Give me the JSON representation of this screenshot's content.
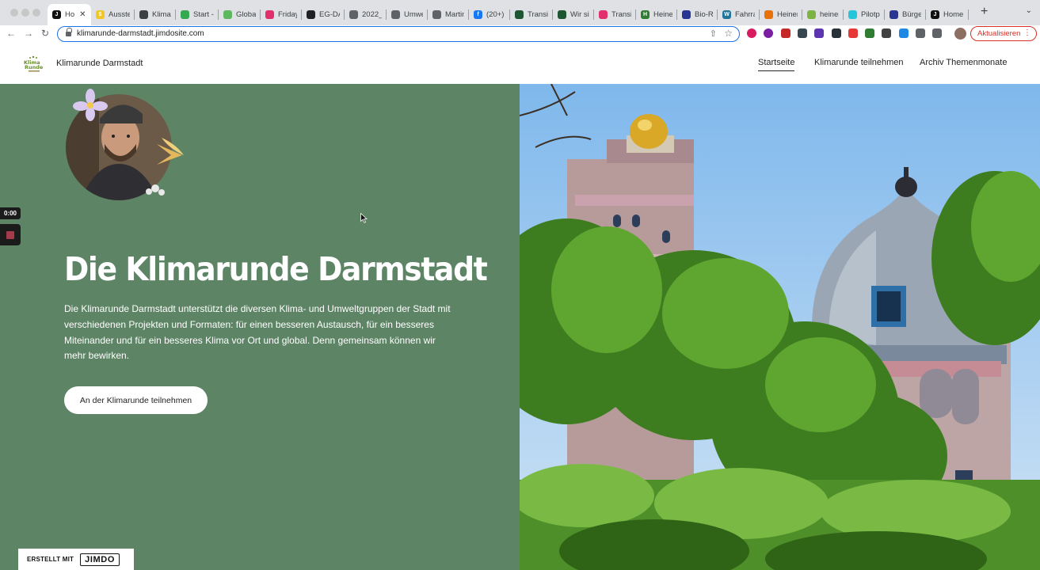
{
  "browser": {
    "tabs": [
      {
        "label": "Ho",
        "icon": "jimdo-icon",
        "color": "#111111",
        "glyph": "J",
        "active": true
      },
      {
        "label": "Ausste",
        "icon": "dollar-icon",
        "color": "#f3c623",
        "glyph": "$"
      },
      {
        "label": "Klima",
        "icon": "box-icon",
        "color": "#3c4043",
        "glyph": ""
      },
      {
        "label": "Start -",
        "icon": "green-circle-icon",
        "color": "#34a853",
        "glyph": ""
      },
      {
        "label": "Global",
        "icon": "green-circle-icon",
        "color": "#5fb85f",
        "glyph": ""
      },
      {
        "label": "Friday",
        "icon": "instagram-icon",
        "color": "#e1306c",
        "glyph": ""
      },
      {
        "label": "EG-DA",
        "icon": "diamond-icon",
        "color": "#202124",
        "glyph": ""
      },
      {
        "label": "2022_",
        "icon": "globe-icon",
        "color": "#5f6368",
        "glyph": ""
      },
      {
        "label": "Umwe",
        "icon": "globe-icon",
        "color": "#5f6368",
        "glyph": ""
      },
      {
        "label": "Martin",
        "icon": "globe-icon",
        "color": "#5f6368",
        "glyph": ""
      },
      {
        "label": "(20+)",
        "icon": "facebook-icon",
        "color": "#1877f2",
        "glyph": "f"
      },
      {
        "label": "Transi",
        "icon": "translate-icon",
        "color": "#1e5631",
        "glyph": ""
      },
      {
        "label": "Wir sir",
        "icon": "translate-icon",
        "color": "#1e5631",
        "glyph": ""
      },
      {
        "label": "Transi",
        "icon": "instagram-icon",
        "color": "#e1306c",
        "glyph": ""
      },
      {
        "label": "Heine",
        "icon": "h-icon",
        "color": "#2e7d32",
        "glyph": "H"
      },
      {
        "label": "Bio-Re",
        "icon": "person-icon",
        "color": "#283593",
        "glyph": ""
      },
      {
        "label": "Fahrra",
        "icon": "wordpress-icon",
        "color": "#21759b",
        "glyph": "W"
      },
      {
        "label": "Heiner",
        "icon": "photo-icon",
        "color": "#e8710a",
        "glyph": ""
      },
      {
        "label": "heiner",
        "icon": "house-icon",
        "color": "#7cb342",
        "glyph": ""
      },
      {
        "label": "Pilotpr",
        "icon": "flag-icon",
        "color": "#26c6da",
        "glyph": ""
      },
      {
        "label": "Bürge",
        "icon": "person-icon",
        "color": "#283593",
        "glyph": ""
      },
      {
        "label": "Home",
        "icon": "jimdo-icon",
        "color": "#111111",
        "glyph": "J"
      }
    ],
    "url": "klimarunde-darmstadt.jimdosite.com",
    "update_label": "Aktualisieren",
    "extension_colors": [
      "#d81b60",
      "#7b1fa2",
      "#c62828",
      "#37474f",
      "#5e35b1",
      "#263238",
      "#e53935",
      "#2e7d32",
      "#424242",
      "#1e88e5",
      "#5f6368",
      "#5f6368"
    ]
  },
  "site": {
    "brand": "Klimarunde Darmstadt",
    "nav": {
      "home": "Startseite",
      "join": "Klimarunde teilnehmen",
      "archive": "Archiv Themenmonate"
    },
    "hero": {
      "title": "Die Klimarunde Darmstadt",
      "text": "Die Klimarunde Darmstadt unterstützt die diversen Klima- und Umweltgruppen der Stadt mit verschiedenen Projekten und Formaten: für einen besseren Austausch, für ein besseres Miteinander und für ein besseres Klima vor Ort und global. Denn gemeinsam können wir mehr bewirken.",
      "cta": "An der Klimarunde teilnehmen",
      "background_color": "#5e8466"
    },
    "badge": {
      "made_with": "ERSTELLT MIT",
      "jimdo": "JIMDO"
    }
  },
  "recorder": {
    "time": "0:00"
  }
}
